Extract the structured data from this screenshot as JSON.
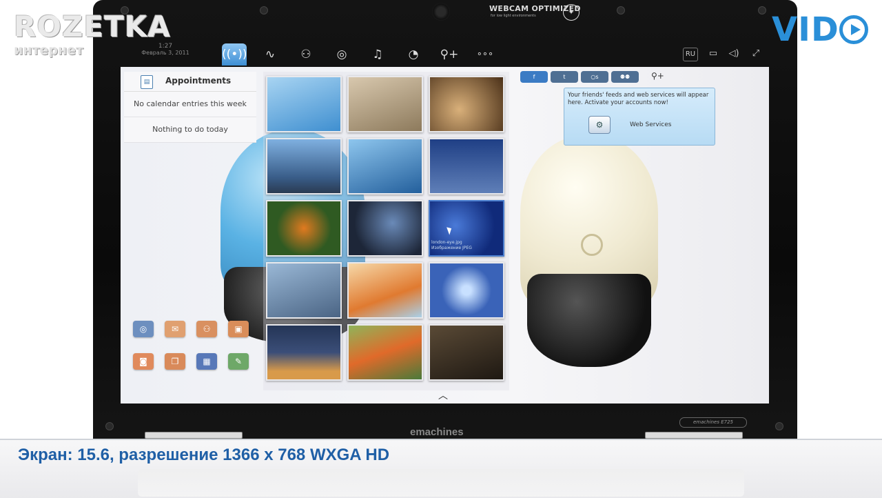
{
  "watermarks": {
    "rozetka": "ROZETKA",
    "rozetka_sub": "интернет",
    "vido": "VID"
  },
  "laptop": {
    "webcam_label": "WEBCAM OPTIMIZED",
    "webcam_sub": "for low light environments",
    "brand": "emachines",
    "model": "emachines E725"
  },
  "taskbar": {
    "clock_time": "1:27",
    "clock_date": "Февраль 3, 2011",
    "tabs": [
      {
        "name": "social",
        "glyph": "((•))",
        "active": true
      },
      {
        "name": "pulse",
        "glyph": "∿",
        "active": false
      },
      {
        "name": "people",
        "glyph": "⚇",
        "active": false
      },
      {
        "name": "disc",
        "glyph": "◎",
        "active": false
      },
      {
        "name": "music",
        "glyph": "♫",
        "active": false
      },
      {
        "name": "chart",
        "glyph": "◔",
        "active": false
      },
      {
        "name": "add-user",
        "glyph": "⚲+",
        "active": false
      },
      {
        "name": "more",
        "glyph": "∘∘∘",
        "active": false
      }
    ],
    "sys": {
      "lang": "RU",
      "battery": "▭",
      "volume": "◁)",
      "network": "⤢"
    }
  },
  "appointments": {
    "title": "Appointments",
    "calendar_note": "No calendar entries this week",
    "todo_note": "Nothing to do today"
  },
  "photos": {
    "hover_name": "london-eye.jpg",
    "hover_type": "Изображение JPEG",
    "tiles": [
      {
        "name": "cherries",
        "color": "#7fb6e0"
      },
      {
        "name": "spring-rolls",
        "color": "#c8b8a0"
      },
      {
        "name": "spiral-stair",
        "color": "#7b5a3a"
      },
      {
        "name": "penguin",
        "color": "#5d8bc2"
      },
      {
        "name": "bird-branch",
        "color": "#3e7fc0"
      },
      {
        "name": "gherkin",
        "color": "#2c4d8e"
      },
      {
        "name": "oranges",
        "color": "#3e6a2c"
      },
      {
        "name": "lens",
        "color": "#2d3f5a"
      },
      {
        "name": "london-eye",
        "color": "#1d3d9a"
      },
      {
        "name": "cat",
        "color": "#6f8ca8"
      },
      {
        "name": "fruit",
        "color": "#e8c090"
      },
      {
        "name": "snowflake",
        "color": "#3a63b8"
      },
      {
        "name": "sunset",
        "color": "#2b3a60"
      },
      {
        "name": "clownfish",
        "color": "#5d8c3a"
      },
      {
        "name": "guitar",
        "color": "#3a3024"
      }
    ]
  },
  "social": {
    "tabs": [
      "f",
      "t",
      "○s",
      "⚉⚉"
    ],
    "message": "Your friends' feeds and web services will appear here. Activate your accounts now!",
    "button_label": "Web Services"
  },
  "dock": [
    {
      "name": "webcam",
      "color": "#6d8fbf"
    },
    {
      "name": "mail",
      "color": "#e0a070"
    },
    {
      "name": "contacts",
      "color": "#d99060"
    },
    {
      "name": "album",
      "color": "#d98d5a"
    },
    {
      "name": "camera",
      "color": "#e08a5c"
    },
    {
      "name": "docs",
      "color": "#d98a5a"
    },
    {
      "name": "window",
      "color": "#5878b8"
    },
    {
      "name": "edit",
      "color": "#6ea868"
    }
  ],
  "caption": "Экран: 15.6,  разрешение 1366 x 768 WXGA HD"
}
